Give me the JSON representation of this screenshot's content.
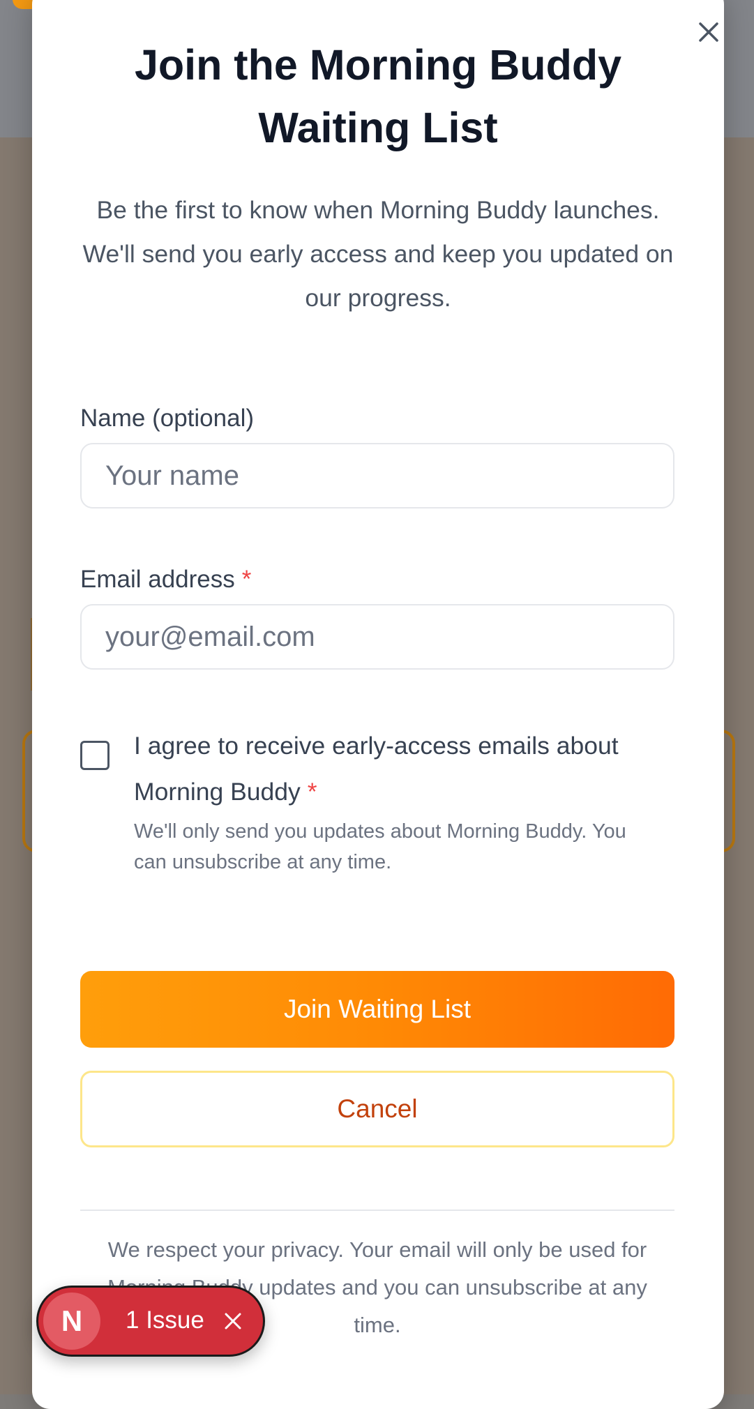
{
  "modal": {
    "title": "Join the Morning Buddy Waiting List",
    "subtitle": "Be the first to know when Morning Buddy launches. We'll send you early access and keep you updated on our progress.",
    "close_icon": "close-icon"
  },
  "form": {
    "name": {
      "label": "Name (optional)",
      "placeholder": "Your name",
      "value": ""
    },
    "email": {
      "label": "Email address",
      "required_mark": "*",
      "placeholder": "your@email.com",
      "value": ""
    },
    "consent": {
      "checked": false,
      "label": "I agree to receive early-access emails about Morning Buddy",
      "required_mark": "*",
      "help": "We'll only send you updates about Morning Buddy. You can unsubscribe at any time."
    },
    "submit_label": "Join Waiting List",
    "cancel_label": "Cancel"
  },
  "privacy_note": "We respect your privacy. Your email will only be used for Morning Buddy updates and you can unsubscribe at any time.",
  "issue_badge": {
    "logo_letter": "N",
    "label": "1 Issue",
    "close_icon": "close-icon"
  },
  "colors": {
    "accent_start": "#ff9e0b",
    "accent_end": "#ff6b05",
    "required": "#ef4444",
    "cancel_text": "#c2410c",
    "badge": "#d12f3a"
  }
}
